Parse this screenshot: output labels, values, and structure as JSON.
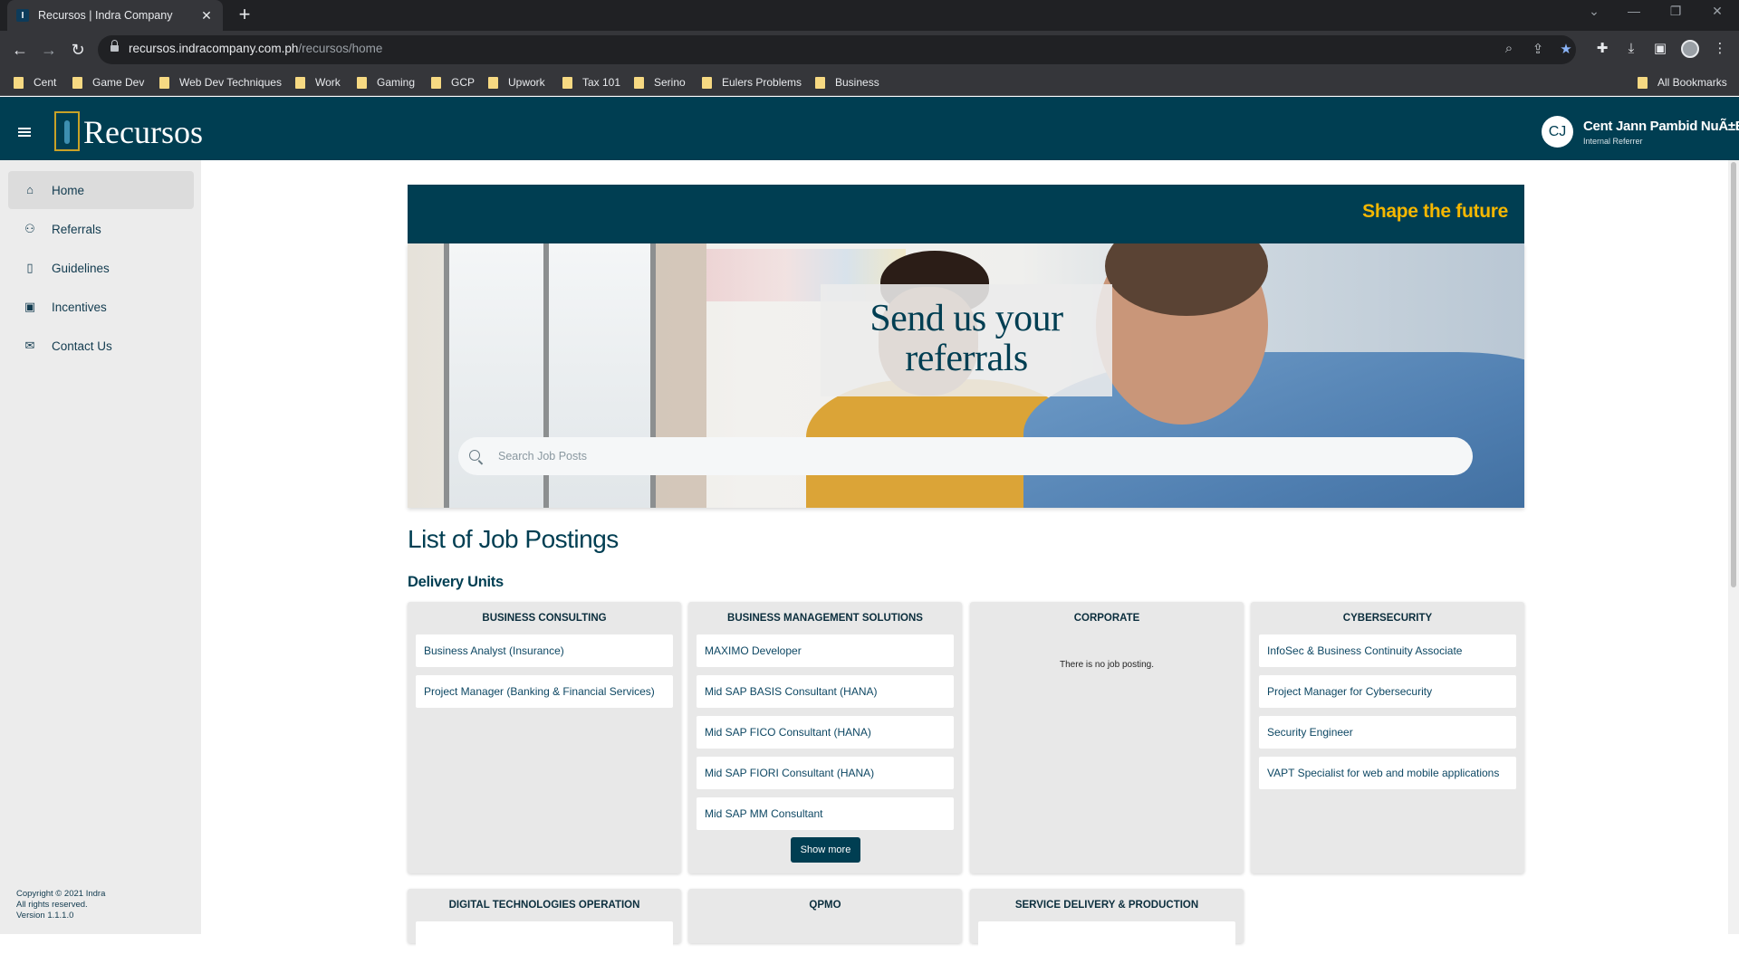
{
  "browser": {
    "tab_title": "Recursos | Indra Company",
    "tab_favicon": "I",
    "url_domain": "recursos.indracompany.com.ph",
    "url_path": "/recursos/home",
    "bookmarks": [
      "Cent",
      "Game Dev",
      "Web Dev Techniques",
      "Work",
      "Gaming",
      "GCP",
      "Upwork",
      "Tax 101",
      "Serino",
      "Eulers Problems",
      "Business"
    ],
    "all_bookmarks": "All Bookmarks",
    "icons": [
      "back-icon",
      "forward-icon",
      "reload-icon",
      "zoom-icon",
      "share-icon",
      "star-icon",
      "extensions-icon",
      "download-icon",
      "sidepanel-icon",
      "profile-icon",
      "menu-icon"
    ]
  },
  "header": {
    "brand": "Recursos",
    "user_initials": "CJ",
    "user_name": "Cent Jann Pambid NuÃ±Ez",
    "user_role": "Internal Referrer"
  },
  "sidebar": {
    "items": [
      {
        "label": "Home",
        "icon": "home-icon",
        "active": true
      },
      {
        "label": "Referrals",
        "icon": "people-icon",
        "active": false
      },
      {
        "label": "Guidelines",
        "icon": "book-icon",
        "active": false
      },
      {
        "label": "Incentives",
        "icon": "gift-icon",
        "active": false
      },
      {
        "label": "Contact Us",
        "icon": "mail-icon",
        "active": false
      }
    ],
    "footer": {
      "copyright": "Copyright © 2021 Indra",
      "rights": "All rights reserved.",
      "version": "Version 1.1.1.0"
    }
  },
  "hero": {
    "tagline": "Shape the future",
    "title_line1": "Send us your",
    "title_line2": "referrals",
    "search_placeholder": "Search Job Posts"
  },
  "main": {
    "title": "List of Job Postings",
    "subtitle": "Delivery Units",
    "units": [
      {
        "name": "BUSINESS CONSULTING",
        "jobs": [
          "Business Analyst (Insurance)",
          "Project Manager (Banking & Financial Services)"
        ]
      },
      {
        "name": "BUSINESS MANAGEMENT SOLUTIONS",
        "jobs": [
          "MAXIMO Developer",
          "Mid SAP BASIS Consultant (HANA)",
          "Mid SAP FICO Consultant (HANA)",
          "Mid SAP FIORI Consultant (HANA)",
          "Mid SAP MM Consultant"
        ],
        "show_more": "Show more"
      },
      {
        "name": "CORPORATE",
        "jobs": [],
        "empty": "There is no job posting."
      },
      {
        "name": "CYBERSECURITY",
        "jobs": [
          "InfoSec & Business Continuity Associate",
          "Project Manager for Cybersecurity",
          "Security Engineer",
          "VAPT Specialist for web and mobile applications"
        ]
      },
      {
        "name": "DIGITAL TECHNOLOGIES OPERATION",
        "jobs": []
      },
      {
        "name": "QPMO",
        "jobs": []
      },
      {
        "name": "SERVICE DELIVERY & PRODUCTION",
        "jobs": []
      }
    ]
  },
  "colors": {
    "header_bg": "#003e52",
    "accent_gold": "#f5b700",
    "sidebar_bg": "#ececec",
    "card_bg": "#e8e8e8"
  }
}
